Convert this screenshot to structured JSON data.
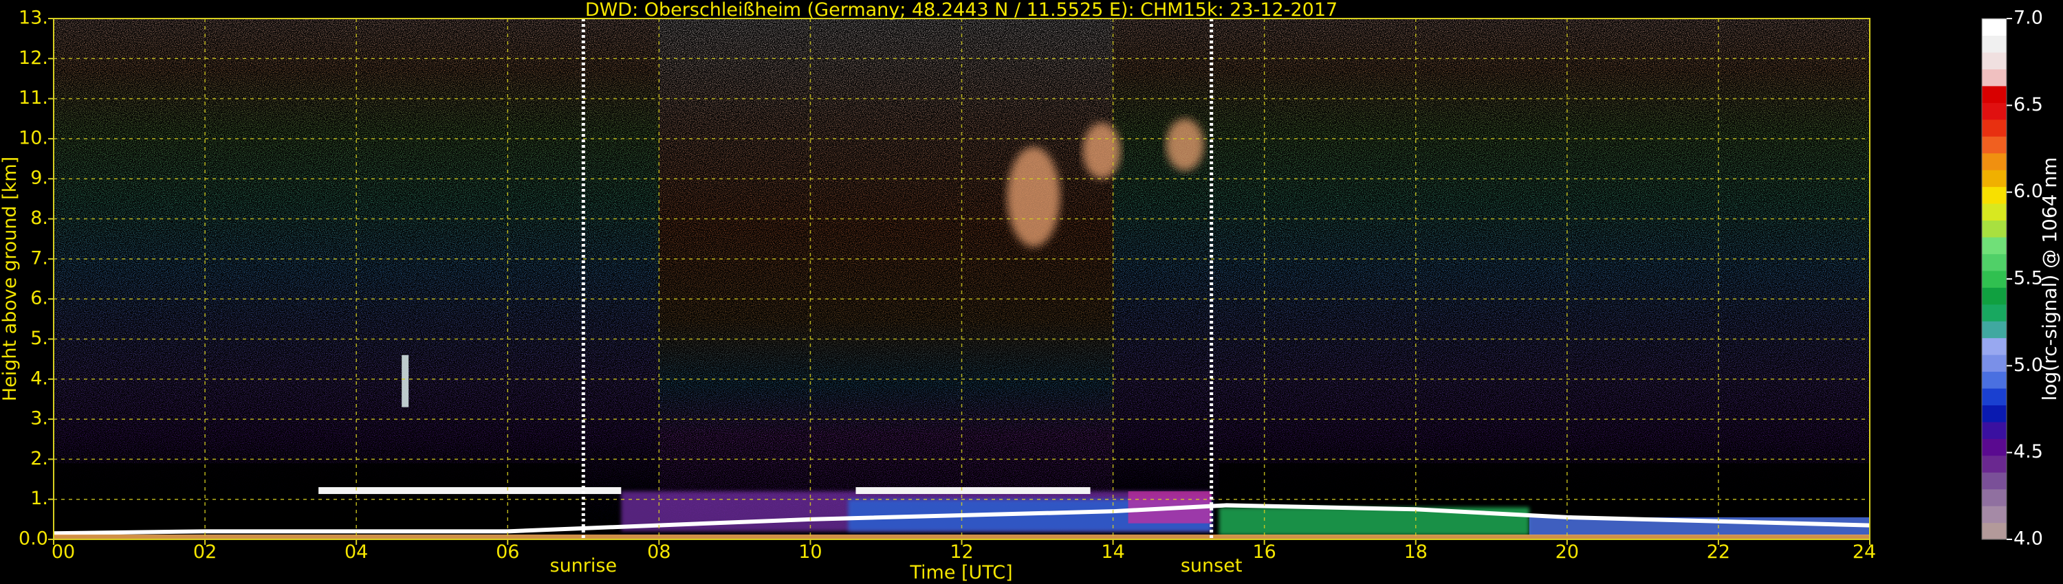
{
  "chart_data": {
    "type": "heatmap",
    "title": "DWD: Oberschleißheim (Germany; 48.2443 N / 11.5525 E):    CHM15k: 23-12-2017",
    "xlabel": "Time [UTC]",
    "ylabel": "Height above ground [km]",
    "x_ticks": [
      "00",
      "02",
      "04",
      "06",
      "08",
      "10",
      "12",
      "14",
      "16",
      "18",
      "20",
      "22",
      "24"
    ],
    "xlim": [
      0,
      24
    ],
    "y_ticks": [
      "0.0",
      "1.",
      "2.",
      "3.",
      "4.",
      "5.",
      "6.",
      "7.",
      "8.",
      "9.",
      "10.",
      "11.",
      "12.",
      "13."
    ],
    "ylim": [
      0,
      13
    ],
    "grid": true,
    "markers": [
      {
        "label": "sunrise",
        "x": 7.0
      },
      {
        "label": "sunset",
        "x": 15.3
      }
    ],
    "colorbar": {
      "label": "log(rc-signal) @ 1064 nm",
      "range": [
        4.0,
        7.0
      ],
      "ticks": [
        "4.0",
        "4.5",
        "5.0",
        "5.5",
        "6.0",
        "6.5",
        "7.0"
      ],
      "colors": [
        "#b39a9a",
        "#a58aa6",
        "#9070a0",
        "#7a5098",
        "#6a2890",
        "#5a0a90",
        "#3a10a0",
        "#0a1ab0",
        "#1a40d0",
        "#4a70e0",
        "#7a90e8",
        "#98a8f0",
        "#40a8a0",
        "#18a860",
        "#10a040",
        "#30c050",
        "#50d068",
        "#70e078",
        "#a8e040",
        "#d8e820",
        "#f8e000",
        "#f0b000",
        "#f09010",
        "#f06020",
        "#e83010",
        "#e01010",
        "#d80000",
        "#f0c0c0",
        "#f0e0e0",
        "#f0f0f0",
        "#ffffff"
      ]
    },
    "features": {
      "cloud_base_km": [
        {
          "x_start": 10.6,
          "x_end": 13.7,
          "height": 1.2
        },
        {
          "x_start": 3.5,
          "x_end": 7.5,
          "height": 1.2
        }
      ],
      "boundary_layer_km": [
        {
          "x": 0,
          "height": 0.15
        },
        {
          "x": 2,
          "height": 0.2
        },
        {
          "x": 6,
          "height": 0.2
        },
        {
          "x": 10,
          "height": 0.5
        },
        {
          "x": 14,
          "height": 0.7
        },
        {
          "x": 15.5,
          "height": 0.85
        },
        {
          "x": 18,
          "height": 0.75
        },
        {
          "x": 20,
          "height": 0.55
        },
        {
          "x": 24,
          "height": 0.35
        }
      ],
      "high_clouds": [
        {
          "x_start": 12.6,
          "x_end": 13.3,
          "y_bottom": 7.3,
          "y_top": 9.8
        },
        {
          "x_start": 13.6,
          "x_end": 14.1,
          "y_bottom": 9.0,
          "y_top": 10.4
        },
        {
          "x_start": 14.7,
          "x_end": 15.2,
          "y_bottom": 9.2,
          "y_top": 10.5
        }
      ]
    }
  }
}
